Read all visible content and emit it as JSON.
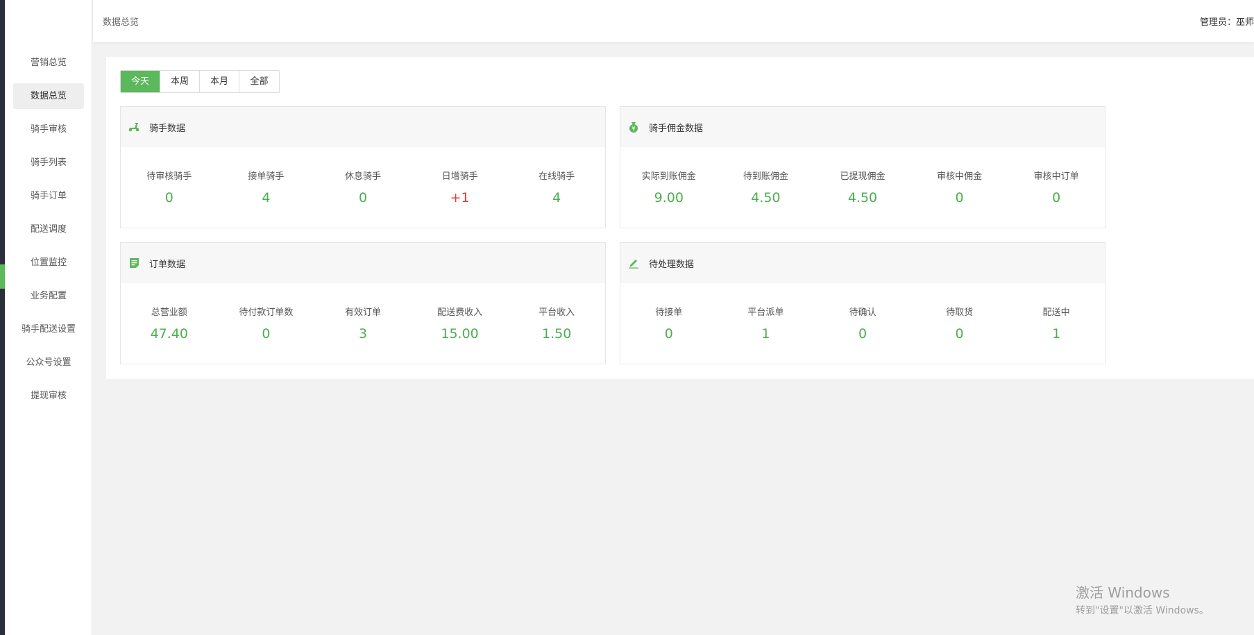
{
  "sidebar": {
    "items": [
      {
        "label": "营销总览"
      },
      {
        "label": "数据总览"
      },
      {
        "label": "骑手审核"
      },
      {
        "label": "骑手列表"
      },
      {
        "label": "骑手订单"
      },
      {
        "label": "配送调度"
      },
      {
        "label": "位置监控"
      },
      {
        "label": "业务配置"
      },
      {
        "label": "骑手配送设置"
      },
      {
        "label": "公众号设置"
      },
      {
        "label": "提现审核"
      }
    ],
    "active_index": 1
  },
  "header": {
    "breadcrumb": "数据总览",
    "admin_label": "管理员：",
    "admin_name": "巫师"
  },
  "tabs": [
    {
      "label": "今天"
    },
    {
      "label": "本周"
    },
    {
      "label": "本月"
    },
    {
      "label": "全部"
    }
  ],
  "active_tab": 0,
  "cards": {
    "rider": {
      "title": "骑手数据",
      "icon": "scooter-icon",
      "stats": [
        {
          "label": "待审核骑手",
          "value": "0"
        },
        {
          "label": "接单骑手",
          "value": "4"
        },
        {
          "label": "休息骑手",
          "value": "0"
        },
        {
          "label": "日增骑手",
          "value": "+1"
        },
        {
          "label": "在线骑手",
          "value": "4"
        }
      ]
    },
    "commission": {
      "title": "骑手佣金数据",
      "icon": "money-bag-icon",
      "stats": [
        {
          "label": "实际到账佣金",
          "value": "9.00"
        },
        {
          "label": "待到账佣金",
          "value": "4.50"
        },
        {
          "label": "已提现佣金",
          "value": "4.50"
        },
        {
          "label": "审核中佣金",
          "value": "0"
        },
        {
          "label": "审核中订单",
          "value": "0"
        }
      ]
    },
    "order": {
      "title": "订单数据",
      "icon": "document-icon",
      "stats": [
        {
          "label": "总营业额",
          "value": "47.40"
        },
        {
          "label": "待付款订单数",
          "value": "0"
        },
        {
          "label": "有效订单",
          "value": "3"
        },
        {
          "label": "配送费收入",
          "value": "15.00"
        },
        {
          "label": "平台收入",
          "value": "1.50"
        }
      ]
    },
    "pending": {
      "title": "待处理数据",
      "icon": "pencil-icon",
      "stats": [
        {
          "label": "待接单",
          "value": "0"
        },
        {
          "label": "平台派单",
          "value": "1"
        },
        {
          "label": "待确认",
          "value": "0"
        },
        {
          "label": "待取货",
          "value": "0"
        },
        {
          "label": "配送中",
          "value": "1"
        }
      ]
    }
  },
  "colors": {
    "accent": "#5cb85c",
    "value_green": "#4caf50",
    "value_red": "#e53935"
  },
  "watermark": {
    "line1": "激活 Windows",
    "line2": "转到\"设置\"以激活 Windows。"
  }
}
